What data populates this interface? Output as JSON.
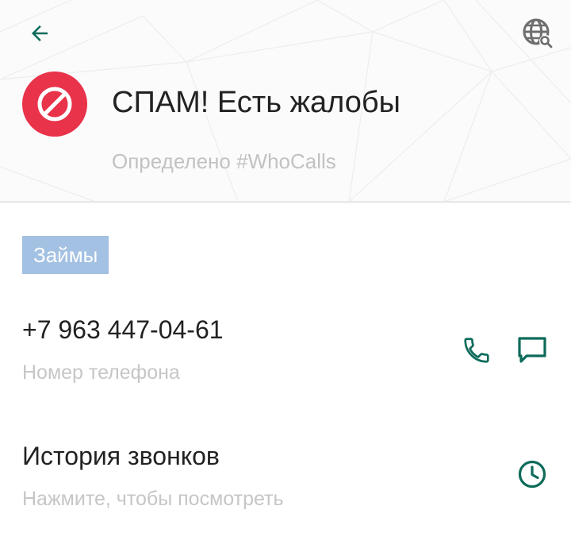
{
  "header": {
    "back_icon": "arrow-left-icon",
    "globe_icon": "globe-search-icon",
    "spam_icon": "block-icon",
    "title": "СПАМ! Есть жалобы",
    "identified_by": "Определено #WhoCalls"
  },
  "tag": {
    "label": "Займы"
  },
  "phone": {
    "number": "+7 963 447-04-61",
    "caption": "Номер телефона",
    "call_icon": "phone-icon",
    "message_icon": "message-icon"
  },
  "history": {
    "title": "История звонков",
    "caption": "Нажмите, чтобы посмотреть",
    "icon": "clock-icon"
  },
  "colors": {
    "accent": "#0d6b5a",
    "spam_red": "#e8334a",
    "tag_bg": "#a3c1e2",
    "text_primary": "#222222",
    "text_secondary": "#c6c6c6"
  }
}
